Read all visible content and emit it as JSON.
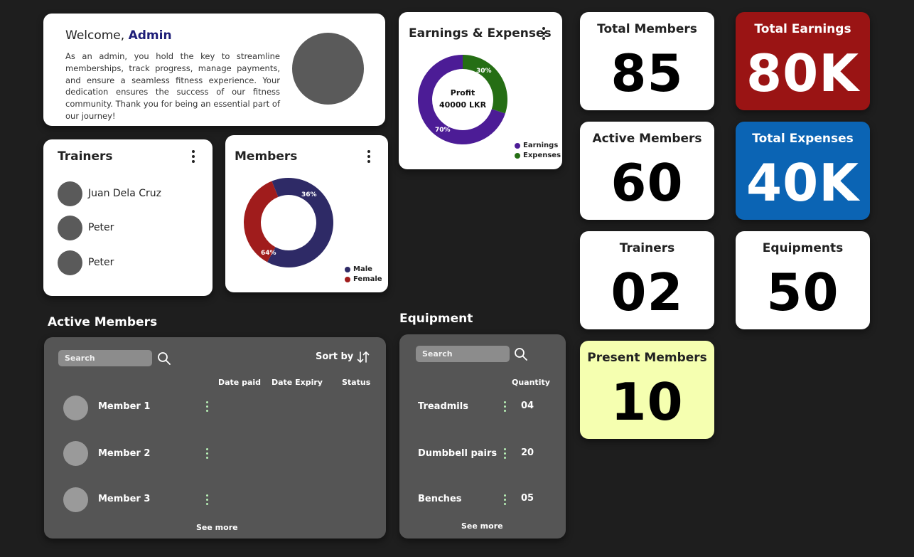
{
  "welcome": {
    "greeting": "Welcome, ",
    "name": "Admin",
    "text": "As an admin, you hold the key to streamline memberships, track progress, manage payments, and ensure a seamless fitness experience. Your dedication ensures the success of our fitness community. Thank you for being an essential part of our journey!"
  },
  "trainers_card": {
    "title": "Trainers",
    "items": [
      {
        "name": "Juan Dela Cruz"
      },
      {
        "name": "Peter"
      },
      {
        "name": "Peter"
      }
    ]
  },
  "members_card": {
    "title": "Members",
    "legend": [
      "Male",
      "Female"
    ]
  },
  "earnings_card": {
    "title": "Earnings & Expenses",
    "center_label": "Profit",
    "center_value": "40000 LKR",
    "legend": [
      "Earnings",
      "Expenses"
    ]
  },
  "chart_data": [
    {
      "type": "pie",
      "categories": [
        "Male",
        "Female"
      ],
      "values": [
        64,
        36
      ],
      "labels": [
        "64%",
        "36%"
      ],
      "colors": [
        "#2e2a66",
        "#a01c1c"
      ]
    },
    {
      "type": "pie",
      "categories": [
        "Earnings",
        "Expenses"
      ],
      "values": [
        70,
        30
      ],
      "labels": [
        "70%",
        "30%"
      ],
      "colors": [
        "#4c1c96",
        "#256e14"
      ]
    }
  ],
  "stats": {
    "total_members": {
      "label": "Total Members",
      "value": "85"
    },
    "total_earnings": {
      "label": "Total Earnings",
      "value": "80K"
    },
    "active_members": {
      "label": "Active Members",
      "value": "60"
    },
    "total_expenses": {
      "label": "Total Expenses",
      "value": "40K"
    },
    "trainers": {
      "label": "Trainers",
      "value": "02"
    },
    "equipments": {
      "label": "Equipments",
      "value": "50"
    },
    "present_members": {
      "label": "Present Members",
      "value": "10"
    }
  },
  "colors": {
    "earnings_card": "#9a1414",
    "expenses_card": "#0b64b4",
    "present_card": "#f5ffb0",
    "panel": "#555555",
    "background": "#1e1e1e"
  },
  "active_members": {
    "title": "Active Members",
    "search_placeholder": "Search",
    "sort_label": "Sort by",
    "columns": [
      "Date paid",
      "Date Expiry",
      "Status"
    ],
    "rows": [
      {
        "name": "Member 1"
      },
      {
        "name": "Member 2"
      },
      {
        "name": "Member 3"
      }
    ],
    "see_more": "See more"
  },
  "equipment": {
    "title": "Equipment",
    "search_placeholder": "Search",
    "column": "Quantity",
    "rows": [
      {
        "name": "Treadmils",
        "qty": "04"
      },
      {
        "name": "Dumbbell pairs",
        "qty": "20"
      },
      {
        "name": "Benches",
        "qty": "05"
      }
    ],
    "see_more": "See more"
  }
}
